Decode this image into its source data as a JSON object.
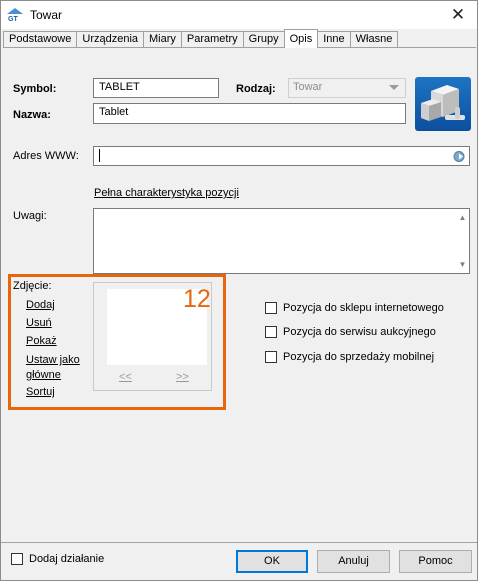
{
  "window": {
    "title": "Towar"
  },
  "tabs": [
    "Podstawowe",
    "Urządzenia",
    "Miary",
    "Parametry",
    "Grupy",
    "Opis",
    "Inne",
    "Własne"
  ],
  "active_tab": "Opis",
  "fields": {
    "symbol_label": "Symbol:",
    "symbol_value": "TABLET",
    "rodzaj_label": "Rodzaj:",
    "rodzaj_value": "Towar",
    "nazwa_label": "Nazwa:",
    "nazwa_value": "Tablet",
    "adres_label": "Adres WWW:",
    "adres_value": "",
    "full_desc_link": "Pełna charakterystyka pozycji",
    "uwagi_label": "Uwagi:"
  },
  "photo": {
    "label": "Zdjęcie:",
    "actions": [
      "Dodaj",
      "Usuń",
      "Pokaż",
      "Ustaw jako główne",
      "Sortuj"
    ],
    "prev": "<<",
    "next": ">>",
    "annotation": "12"
  },
  "checkboxes": [
    {
      "label": "Pozycja do sklepu internetowego",
      "checked": false
    },
    {
      "label": "Pozycja do serwisu aukcyjnego",
      "checked": false
    },
    {
      "label": "Pozycja do sprzedaży mobilnej",
      "checked": false
    }
  ],
  "footer": {
    "add_action_label": "Dodaj działanie",
    "add_action_checked": false,
    "ok": "OK",
    "cancel": "Anuluj",
    "help": "Pomoc"
  },
  "colors": {
    "annotation": "#e8650b",
    "accent": "#0078d7"
  }
}
